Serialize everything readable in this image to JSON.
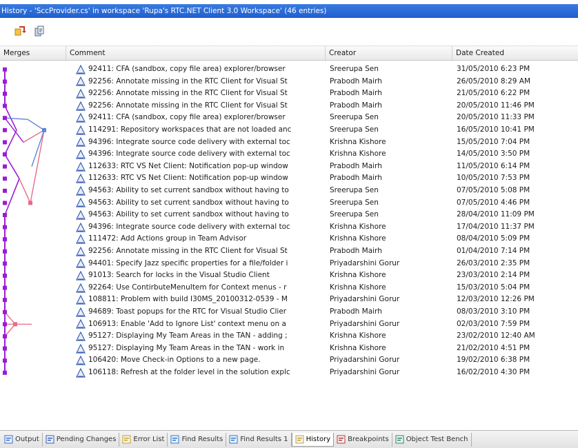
{
  "window": {
    "title": "History - 'SccProvider.cs' in workspace 'Rupa's RTC.NET Client 3.0 Workspace' (46 entries)"
  },
  "toolbar": {
    "buttons": [
      {
        "icon": "compare-icon"
      },
      {
        "icon": "open-icon"
      }
    ]
  },
  "columns": {
    "merges": "Merges",
    "comment": "Comment",
    "creator": "Creator",
    "date": "Date Created"
  },
  "rows": [
    {
      "comment": "92411: CFA (sandbox, copy file area) explorer/browser",
      "creator": "Sreerupa Sen",
      "date": "31/05/2010 6:23 PM"
    },
    {
      "comment": "92256: Annotate missing in the RTC Client for Visual St",
      "creator": "Prabodh Mairh",
      "date": "26/05/2010 8:29 AM"
    },
    {
      "comment": "92256: Annotate missing in the RTC Client for Visual St",
      "creator": "Prabodh Mairh",
      "date": "21/05/2010 6:22 PM"
    },
    {
      "comment": "92256: Annotate missing in the RTC Client for Visual St",
      "creator": "Prabodh Mairh",
      "date": "20/05/2010 11:46 PM"
    },
    {
      "comment": "92411: CFA (sandbox, copy file area) explorer/browser",
      "creator": "Sreerupa Sen",
      "date": "20/05/2010 11:33 PM"
    },
    {
      "comment": "114291: Repository workspaces that are not loaded anc",
      "creator": "Sreerupa Sen",
      "date": "16/05/2010 10:41 PM"
    },
    {
      "comment": "94396: Integrate source code delivery with external toc",
      "creator": "Krishna Kishore",
      "date": "15/05/2010 7:04 PM"
    },
    {
      "comment": "94396: Integrate source code delivery with external toc",
      "creator": "Krishna Kishore",
      "date": "14/05/2010 3:50 PM"
    },
    {
      "comment": "112633: RTC VS Net Client: Notification pop-up window",
      "creator": "Prabodh Mairh",
      "date": "11/05/2010 6:14 PM"
    },
    {
      "comment": "112633: RTC VS Net Client: Notification pop-up window",
      "creator": "Prabodh Mairh",
      "date": "10/05/2010 7:53 PM"
    },
    {
      "comment": "94563: Ability to set current sandbox without having to",
      "creator": "Sreerupa Sen",
      "date": "07/05/2010 5:08 PM"
    },
    {
      "comment": "94563: Ability to set current sandbox without having to",
      "creator": "Sreerupa Sen",
      "date": "07/05/2010 4:46 PM"
    },
    {
      "comment": "94563: Ability to set current sandbox without having to",
      "creator": "Sreerupa Sen",
      "date": "28/04/2010 11:09 PM"
    },
    {
      "comment": "94396: Integrate source code delivery with external toc",
      "creator": "Krishna Kishore",
      "date": "17/04/2010 11:37 PM"
    },
    {
      "comment": "111472: Add Actions group in Team Advisor",
      "creator": "Krishna Kishore",
      "date": "08/04/2010 5:09 PM"
    },
    {
      "comment": "92256: Annotate missing in the RTC Client for Visual St",
      "creator": "Prabodh Mairh",
      "date": "01/04/2010 7:14 PM"
    },
    {
      "comment": "94401: Specify Jazz specific properties for a file/folder i",
      "creator": "Priyadarshini Gorur",
      "date": "26/03/2010 2:35 PM"
    },
    {
      "comment": "91013: Search for locks in the Visual Studio Client",
      "creator": "Krishna Kishore",
      "date": "23/03/2010 2:14 PM"
    },
    {
      "comment": "92264: Use ContirbuteMenuItem for Context menus - r",
      "creator": "Krishna Kishore",
      "date": "15/03/2010 5:04 PM"
    },
    {
      "comment": "108811: Problem with build I30MS_20100312-0539 - M",
      "creator": "Priyadarshini Gorur",
      "date": "12/03/2010 12:26 PM"
    },
    {
      "comment": "94689: Toast popups for the RTC for Visual Studio Clier",
      "creator": "Prabodh Mairh",
      "date": "08/03/2010 3:10 PM"
    },
    {
      "comment": "106913: Enable 'Add to Ignore List' context menu on a",
      "creator": "Priyadarshini Gorur",
      "date": "02/03/2010 7:59 PM"
    },
    {
      "comment": "95127: Displaying My Team Areas in the TAN - adding ;",
      "creator": "Krishna Kishore",
      "date": "23/02/2010 12:40 AM"
    },
    {
      "comment": "95127: Displaying My Team Areas in the TAN - work in",
      "creator": "Krishna Kishore",
      "date": "21/02/2010 4:51 PM"
    },
    {
      "comment": "106420: Move Check-in Options to a new page.",
      "creator": "Priyadarshini Gorur",
      "date": "19/02/2010 6:38 PM"
    },
    {
      "comment": "106118: Refresh at the folder level in the solution explc",
      "creator": "Priyadarshini Gorur",
      "date": "16/02/2010 4:30 PM"
    }
  ],
  "tabs": [
    {
      "label": "Output",
      "icon": "output-icon",
      "active": false
    },
    {
      "label": "Pending Changes",
      "icon": "pending-changes-icon",
      "active": false
    },
    {
      "label": "Error List",
      "icon": "error-list-icon",
      "active": false
    },
    {
      "label": "Find Results",
      "icon": "find-results-icon",
      "active": false
    },
    {
      "label": "Find Results 1",
      "icon": "find-results-icon",
      "active": false
    },
    {
      "label": "History",
      "icon": "history-icon",
      "active": true
    },
    {
      "label": "Breakpoints",
      "icon": "breakpoints-icon",
      "active": false
    },
    {
      "label": "Object Test Bench",
      "icon": "object-test-bench-icon",
      "active": false
    }
  ],
  "colors": {
    "title_bg": "#1f5fcf",
    "merge_main": "#9b1bd6",
    "merge_blue": "#5a86d6",
    "merge_pink": "#e86a8a",
    "changeset_icon": "#3a5fb0"
  }
}
